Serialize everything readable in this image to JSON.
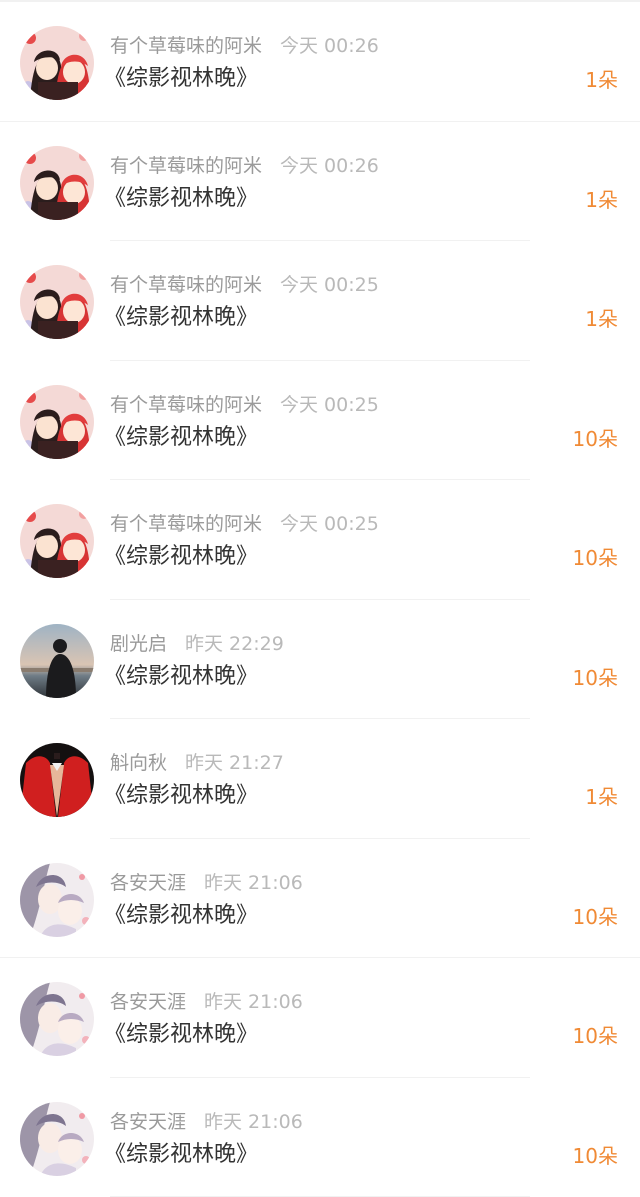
{
  "gift_list": {
    "items": [
      {
        "name": "有个草莓味的阿米",
        "time": "今天 00:26",
        "title": "《综影视林晚》",
        "amount": "1朵",
        "avatar": "anime-couple"
      },
      {
        "name": "有个草莓味的阿米",
        "time": "今天 00:26",
        "title": "《综影视林晚》",
        "amount": "1朵",
        "avatar": "anime-couple"
      },
      {
        "name": "有个草莓味的阿米",
        "time": "今天 00:25",
        "title": "《综影视林晚》",
        "amount": "1朵",
        "avatar": "anime-couple"
      },
      {
        "name": "有个草莓味的阿米",
        "time": "今天 00:25",
        "title": "《综影视林晚》",
        "amount": "10朵",
        "avatar": "anime-couple"
      },
      {
        "name": "有个草莓味的阿米",
        "time": "今天 00:25",
        "title": "《综影视林晚》",
        "amount": "10朵",
        "avatar": "anime-couple"
      },
      {
        "name": "剧光启",
        "time": "昨天 22:29",
        "title": "《综影视林晚》",
        "amount": "10朵",
        "avatar": "sunset-silhouette"
      },
      {
        "name": "斛向秋",
        "time": "昨天 21:27",
        "title": "《综影视林晚》",
        "amount": "1朵",
        "avatar": "red-jacket"
      },
      {
        "name": "各安天涯",
        "time": "昨天 21:06",
        "title": "《综影视林晚》",
        "amount": "10朵",
        "avatar": "illustrated-couple"
      },
      {
        "name": "各安天涯",
        "time": "昨天 21:06",
        "title": "《综影视林晚》",
        "amount": "10朵",
        "avatar": "illustrated-couple"
      },
      {
        "name": "各安天涯",
        "time": "昨天 21:06",
        "title": "《综影视林晚》",
        "amount": "10朵",
        "avatar": "illustrated-couple"
      }
    ]
  },
  "colors": {
    "accent": "#f08a35",
    "name_text": "#9a9a9a",
    "time_text": "#b9b9b9",
    "title_text": "#333333",
    "divider": "#f1f1f1"
  }
}
